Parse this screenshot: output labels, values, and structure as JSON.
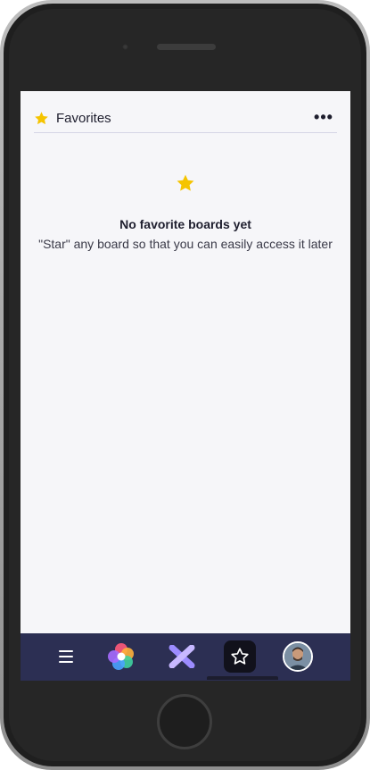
{
  "header": {
    "title": "Favorites",
    "star_icon": "star-filled-icon",
    "more_icon": "more-horizontal-icon",
    "more_label": "•••"
  },
  "empty_state": {
    "icon": "star-filled-icon",
    "title": "No favorite boards yet",
    "description": "\"Star\" any board so that you can easily access it later"
  },
  "bottom_nav": {
    "items": [
      {
        "icon": "hamburger-menu-icon"
      },
      {
        "icon": "color-wheel-logo-icon"
      },
      {
        "icon": "workspace-x-icon"
      },
      {
        "icon": "star-outline-icon",
        "active": true
      },
      {
        "icon": "user-avatar"
      }
    ]
  },
  "colors": {
    "accent_star": "#F5C400",
    "nav_background": "#2C2F53",
    "screen_background": "#F6F6F9",
    "text_primary": "#1E1E2E"
  }
}
